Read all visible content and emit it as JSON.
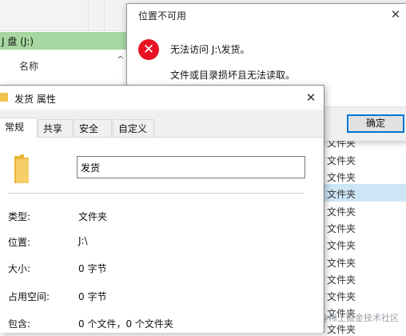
{
  "explorer": {
    "drive_label": "J 盘 (J:)",
    "column_header": "名称",
    "rows": [
      "文件夹",
      "文件夹",
      "文件夹",
      "文件夹",
      "文件夹",
      "文件夹",
      "文件夹",
      "文件夹",
      "文件夹",
      "文件夹",
      "文件夹",
      "文件夹"
    ],
    "watermark": "@稀土掘金技术社区"
  },
  "error_dialog": {
    "title": "位置不可用",
    "message": "无法访问 J:\\发货。",
    "detail": "文件或目录损坏且无法读取。",
    "ok_label": "确定"
  },
  "properties": {
    "title": "发货 属性",
    "tabs": [
      "常规",
      "共享",
      "安全",
      "自定义"
    ],
    "name_value": "发货",
    "fields": [
      {
        "label": "类型:",
        "value": "文件夹"
      },
      {
        "label": "位置:",
        "value": "J:\\"
      },
      {
        "label": "大小:",
        "value": "0 字节"
      },
      {
        "label": "占用空间:",
        "value": "0 字节"
      },
      {
        "label": "包含:",
        "value": "0 个文件，0 个文件夹"
      }
    ]
  },
  "colors": {
    "drive_bar": "#a6d7a0",
    "error_red": "#e81123",
    "accent_blue": "#0078d7",
    "folder_yellow": "#f2c14e"
  }
}
